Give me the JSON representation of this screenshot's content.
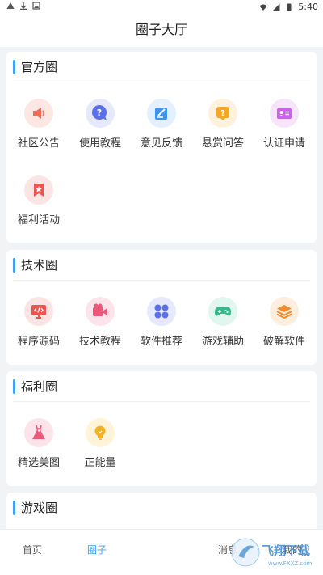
{
  "status": {
    "time": "5:40"
  },
  "header": {
    "title": "圈子大厅"
  },
  "sections": [
    {
      "title": "官方圈",
      "items": [
        {
          "label": "社区公告",
          "icon": "megaphone-icon",
          "bg": "#fde7e3",
          "fg": "#f26b55"
        },
        {
          "label": "使用教程",
          "icon": "question-chat-icon",
          "bg": "#e6e9fb",
          "fg": "#5b6fe8"
        },
        {
          "label": "意见反馈",
          "icon": "edit-note-icon",
          "bg": "#e3f0fd",
          "fg": "#3d93f2"
        },
        {
          "label": "悬赏问答",
          "icon": "question-box-icon",
          "bg": "#fff1dc",
          "fg": "#f5a623"
        },
        {
          "label": "认证申请",
          "icon": "id-card-icon",
          "bg": "#f6e4fb",
          "fg": "#c665e6"
        },
        {
          "label": "福利活动",
          "icon": "star-bookmark-icon",
          "bg": "#fde4e4",
          "fg": "#ef5350"
        }
      ]
    },
    {
      "title": "技术圈",
      "items": [
        {
          "label": "程序源码",
          "icon": "code-monitor-icon",
          "bg": "#fde4e4",
          "fg": "#ef5350"
        },
        {
          "label": "技术教程",
          "icon": "video-camera-icon",
          "bg": "#fde3ea",
          "fg": "#f0557a"
        },
        {
          "label": "软件推荐",
          "icon": "apps-grid-icon",
          "bg": "#e6e9fb",
          "fg": "#5b6fe8"
        },
        {
          "label": "游戏辅助",
          "icon": "gamepad-icon",
          "bg": "#e1f6ef",
          "fg": "#33b98a"
        },
        {
          "label": "破解软件",
          "icon": "layers-icon",
          "bg": "#fdeedd",
          "fg": "#f28a2e"
        }
      ]
    },
    {
      "title": "福利圈",
      "items": [
        {
          "label": "精选美图",
          "icon": "dress-icon",
          "bg": "#fde3ea",
          "fg": "#f0557a"
        },
        {
          "label": "正能量",
          "icon": "lightbulb-icon",
          "bg": "#fff3d9",
          "fg": "#f5b323"
        }
      ]
    },
    {
      "title": "游戏圈",
      "items": []
    }
  ],
  "nav": {
    "home": "首页",
    "circle": "圈子",
    "message": "消息",
    "mine": "我的"
  },
  "watermark": {
    "text": "飞翔下载",
    "sub": "www.FXXZ.com"
  },
  "colors": {
    "accent": "#3da2f5"
  }
}
